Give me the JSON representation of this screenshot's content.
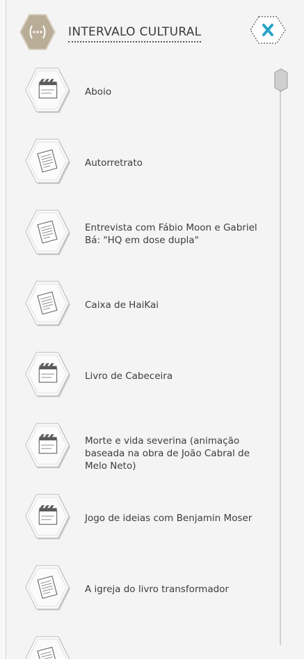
{
  "header": {
    "title": "INTERVALO CULTURAL",
    "logo_icon": "ellipsis-hex-icon",
    "close_icon": "close-icon",
    "accent": "#2aa3c9",
    "hex_fill": "#b9ad98"
  },
  "items": [
    {
      "label": "Aboio",
      "icon": "clapperboard-icon"
    },
    {
      "label": "Autorretrato",
      "icon": "document-icon"
    },
    {
      "label": "Entrevista com Fábio Moon e Gabriel Bá: \"HQ em dose dupla\"",
      "icon": "document-icon"
    },
    {
      "label": "Caixa de HaiKai",
      "icon": "document-icon"
    },
    {
      "label": "Livro de Cabeceira",
      "icon": "clapperboard-icon"
    },
    {
      "label": "Morte e vida severina (animação baseada na obra de João Cabral de Melo Neto)",
      "icon": "clapperboard-icon"
    },
    {
      "label": "Jogo de ideias com Benjamin Moser",
      "icon": "clapperboard-icon"
    },
    {
      "label": "A igreja do livro transformador",
      "icon": "document-icon"
    },
    {
      "label": "",
      "icon": "document-icon"
    }
  ]
}
